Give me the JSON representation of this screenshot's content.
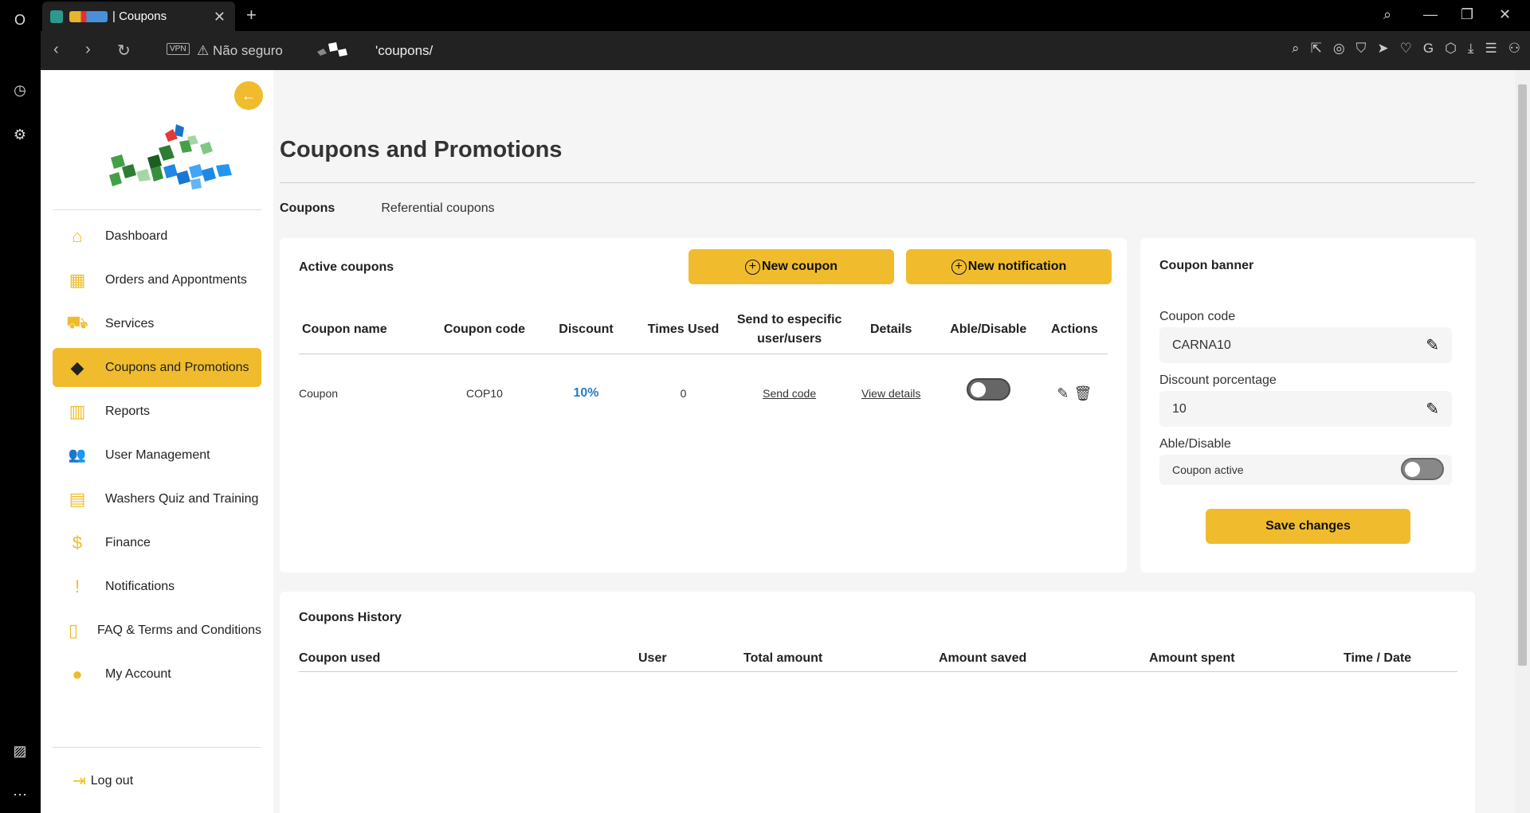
{
  "browser": {
    "tab_title": "| Coupons",
    "new_tab": "+",
    "vpn": "VPN",
    "security": "Não seguro",
    "url": "'coupons/"
  },
  "sidebar": {
    "items": [
      {
        "label": "Dashboard",
        "icon": "home-icon",
        "glyph": "⌂"
      },
      {
        "label": "Orders and Appontments",
        "icon": "calendar-icon",
        "glyph": "▦"
      },
      {
        "label": "Services",
        "icon": "car-icon",
        "glyph": "⛟"
      },
      {
        "label": "Coupons and Promotions",
        "icon": "tag-icon",
        "glyph": "◆",
        "active": true
      },
      {
        "label": "Reports",
        "icon": "reports-icon",
        "glyph": "▥"
      },
      {
        "label": "User Management",
        "icon": "users-icon",
        "glyph": "👥"
      },
      {
        "label": "Washers Quiz and Training",
        "icon": "document-icon",
        "glyph": "▤"
      },
      {
        "label": "Finance",
        "icon": "dollar-icon",
        "glyph": "$"
      },
      {
        "label": "Notifications",
        "icon": "alert-icon",
        "glyph": "!"
      },
      {
        "label": "FAQ & Terms and Conditions",
        "icon": "file-icon",
        "glyph": "▯"
      },
      {
        "label": "My Account",
        "icon": "user-icon",
        "glyph": "●"
      }
    ],
    "logout": "Log out"
  },
  "main": {
    "title": "Coupons and Promotions",
    "tabs": [
      "Coupons",
      "Referential coupons"
    ]
  },
  "active_coupons": {
    "heading": "Active coupons",
    "new_coupon": "New coupon",
    "new_notification": "New notification",
    "columns": [
      "Coupon name",
      "Coupon code",
      "Discount",
      "Times Used",
      "Send to especific user/users",
      "Details",
      "Able/Disable",
      "Actions"
    ],
    "rows": [
      {
        "name": "Coupon",
        "code": "COP10",
        "discount": "10%",
        "times_used": "0",
        "send": "Send code",
        "details": "View details",
        "enabled": false
      }
    ]
  },
  "banner": {
    "heading": "Coupon banner",
    "code_label": "Coupon code",
    "code_value": "CARNA10",
    "discount_label": "Discount porcentage",
    "discount_value": "10",
    "able_label": "Able/Disable",
    "toggle_text": "Coupon active",
    "save": "Save changes"
  },
  "history": {
    "heading": "Coupons History",
    "columns": [
      "Coupon used",
      "User",
      "Total amount",
      "Amount saved",
      "Amount spent",
      "Time / Date"
    ]
  },
  "colors": {
    "accent": "#f0bc2d",
    "link_blue": "#2a7bc2"
  }
}
